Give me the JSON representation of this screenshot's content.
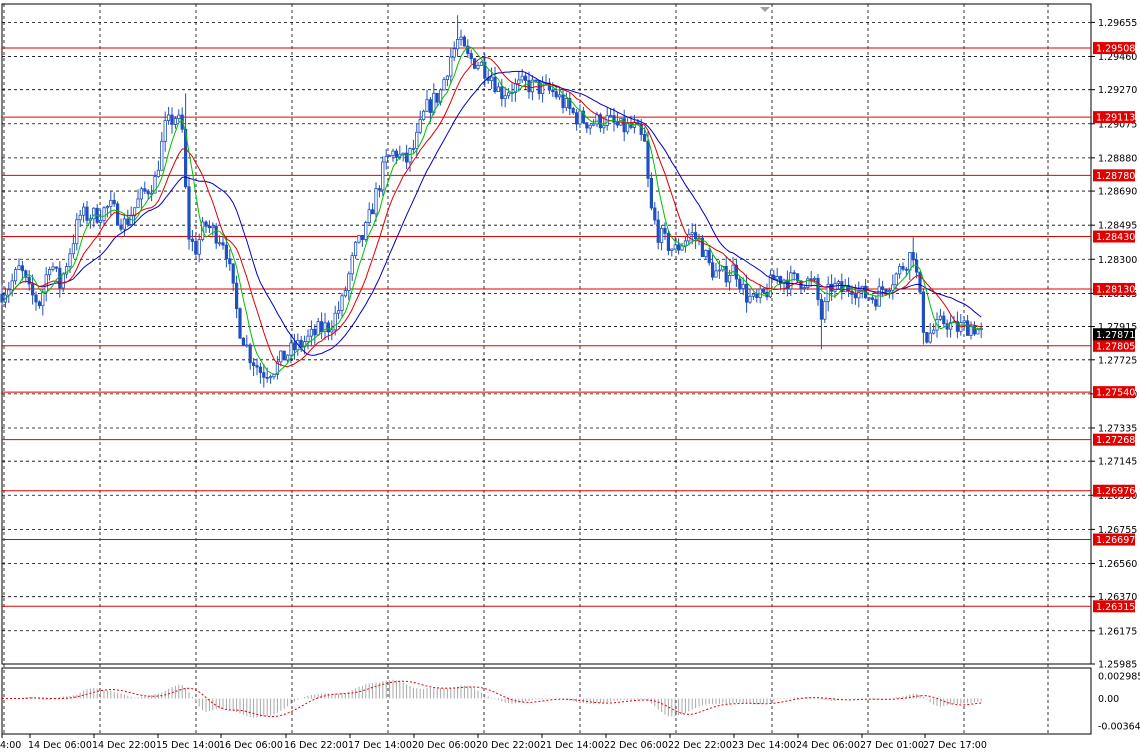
{
  "chart_data": {
    "type": "candlestick",
    "price_axis": {
      "min": 1.25985,
      "max": 1.2976,
      "ticks": [
        "1.29655",
        "1.29460",
        "1.29270",
        "1.29075",
        "1.28880",
        "1.28690",
        "1.28495",
        "1.28300",
        "1.28105",
        "1.27915",
        "1.27725",
        "1.27530",
        "1.27335",
        "1.27145",
        "1.26950",
        "1.26755",
        "1.26560",
        "1.26370",
        "1.26175",
        "1.25985"
      ]
    },
    "time_axis": {
      "labels": [
        "4:00",
        "14 Dec 06:00",
        "14 Dec 22:00",
        "15 Dec 14:00",
        "16 Dec 06:00",
        "16 Dec 22:00",
        "17 Dec 14:00",
        "20 Dec 06:00",
        "20 Dec 22:00",
        "21 Dec 14:00",
        "22 Dec 06:00",
        "22 Dec 22:00",
        "23 Dec 14:00",
        "24 Dec 06:00",
        "27 Dec 01:00",
        "27 Dec 17:00"
      ]
    },
    "current_price": "1.27871",
    "levels": [
      "1.29508",
      "1.29113",
      "1.28780",
      "1.28430",
      "1.28130",
      "1.27805",
      "1.27540",
      "1.27268",
      "1.26976",
      "1.26697",
      "1.26315"
    ],
    "path_points": [
      [
        0,
        1.281
      ],
      [
        10,
        1.2815
      ],
      [
        20,
        1.2825
      ],
      [
        30,
        1.281
      ],
      [
        40,
        1.2805
      ],
      [
        50,
        1.283
      ],
      [
        60,
        1.2815
      ],
      [
        70,
        1.2835
      ],
      [
        80,
        1.2855
      ],
      [
        95,
        1.2855
      ],
      [
        110,
        1.286
      ],
      [
        125,
        1.285
      ],
      [
        140,
        1.2865
      ],
      [
        155,
        1.2875
      ],
      [
        165,
        1.2905
      ],
      [
        175,
        1.2912
      ],
      [
        182,
        1.2905
      ],
      [
        188,
        1.2845
      ],
      [
        195,
        1.2835
      ],
      [
        205,
        1.285
      ],
      [
        215,
        1.2845
      ],
      [
        225,
        1.284
      ],
      [
        232,
        1.2815
      ],
      [
        240,
        1.279
      ],
      [
        250,
        1.2775
      ],
      [
        262,
        1.2765
      ],
      [
        275,
        1.2768
      ],
      [
        285,
        1.2775
      ],
      [
        297,
        1.278
      ],
      [
        310,
        1.2785
      ],
      [
        320,
        1.279
      ],
      [
        330,
        1.2792
      ],
      [
        342,
        1.2805
      ],
      [
        355,
        1.2835
      ],
      [
        365,
        1.2845
      ],
      [
        375,
        1.2865
      ],
      [
        385,
        1.2885
      ],
      [
        395,
        1.2892
      ],
      [
        405,
        1.2885
      ],
      [
        415,
        1.2895
      ],
      [
        425,
        1.2915
      ],
      [
        440,
        1.2925
      ],
      [
        450,
        1.2945
      ],
      [
        458,
        1.2955
      ],
      [
        468,
        1.2945
      ],
      [
        480,
        1.2942
      ],
      [
        492,
        1.2935
      ],
      [
        500,
        1.2925
      ],
      [
        512,
        1.2928
      ],
      [
        525,
        1.293
      ],
      [
        540,
        1.2928
      ],
      [
        555,
        1.2925
      ],
      [
        565,
        1.2918
      ],
      [
        575,
        1.2912
      ],
      [
        590,
        1.2908
      ],
      [
        605,
        1.291
      ],
      [
        620,
        1.2905
      ],
      [
        635,
        1.2905
      ],
      [
        645,
        1.2895
      ],
      [
        650,
        1.286
      ],
      [
        658,
        1.2845
      ],
      [
        665,
        1.284
      ],
      [
        675,
        1.2835
      ],
      [
        690,
        1.2845
      ],
      [
        700,
        1.284
      ],
      [
        710,
        1.2825
      ],
      [
        720,
        1.282
      ],
      [
        735,
        1.2825
      ],
      [
        745,
        1.281
      ],
      [
        755,
        1.2805
      ],
      [
        765,
        1.281
      ],
      [
        775,
        1.282
      ],
      [
        790,
        1.2818
      ],
      [
        805,
        1.2818
      ],
      [
        815,
        1.2815
      ],
      [
        822,
        1.2795
      ],
      [
        830,
        1.2815
      ],
      [
        842,
        1.2812
      ],
      [
        852,
        1.2815
      ],
      [
        862,
        1.281
      ],
      [
        875,
        1.2808
      ],
      [
        885,
        1.2815
      ],
      [
        895,
        1.282
      ],
      [
        905,
        1.2828
      ],
      [
        913,
        1.2835
      ],
      [
        918,
        1.2815
      ],
      [
        925,
        1.2785
      ],
      [
        935,
        1.279
      ],
      [
        945,
        1.2795
      ],
      [
        955,
        1.279
      ],
      [
        965,
        1.2792
      ],
      [
        975,
        1.2791
      ],
      [
        982,
        1.2787
      ]
    ],
    "ma_fast_color": "#00c000",
    "ma_mid_color": "#e00000",
    "ma_slow_color": "#0000c0",
    "candle_color": "#2050c0",
    "level_color": "#e00000",
    "oscillator": {
      "ticks": [
        "0.002985",
        "0.00",
        "-0.00364"
      ],
      "histogram_color": "#a8a8a8",
      "signal_color": "#e00000"
    }
  }
}
